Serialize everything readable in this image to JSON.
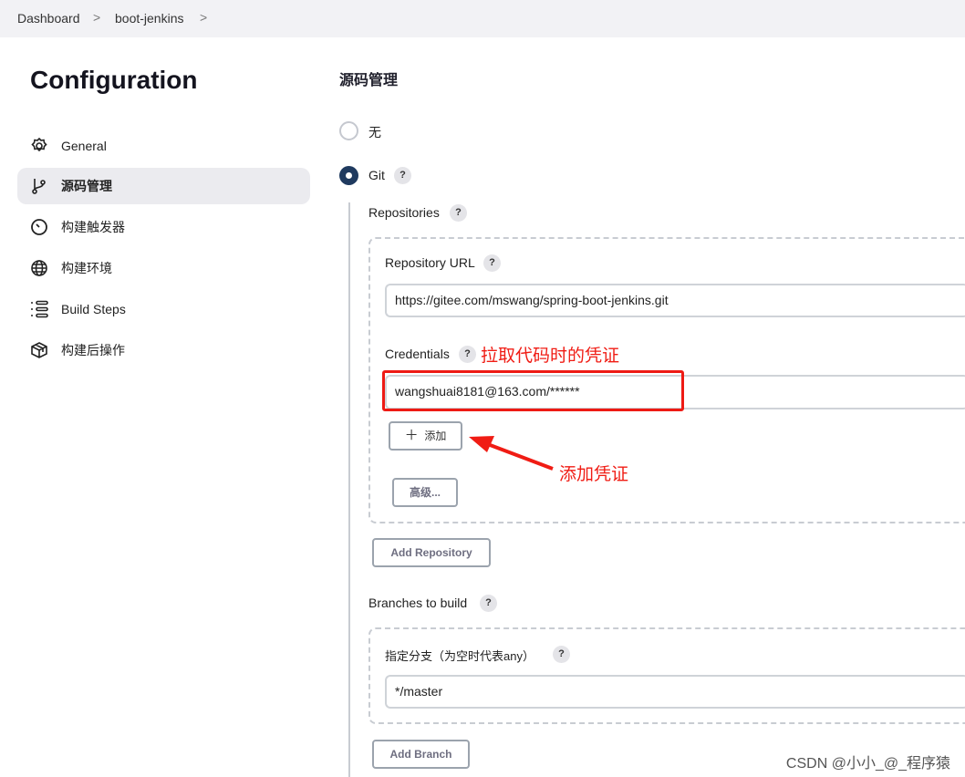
{
  "breadcrumb": {
    "items": [
      "Dashboard",
      "boot-jenkins"
    ]
  },
  "page_title": "Configuration",
  "sidebar": {
    "items": [
      {
        "label": "General",
        "icon": "gear-icon"
      },
      {
        "label": "源码管理",
        "icon": "git-branch-icon",
        "active": true
      },
      {
        "label": "构建触发器",
        "icon": "timer-icon"
      },
      {
        "label": "构建环境",
        "icon": "globe-icon"
      },
      {
        "label": "Build Steps",
        "icon": "list-icon"
      },
      {
        "label": "构建后操作",
        "icon": "package-icon"
      }
    ]
  },
  "scm": {
    "heading": "源码管理",
    "option_none": "无",
    "option_git": "Git",
    "selected": "Git",
    "repositories_label": "Repositories",
    "repo_url_label": "Repository URL",
    "repo_url": "https://gitee.com/mswang/spring-boot-jenkins.git",
    "credentials_label": "Credentials",
    "credentials_value": "wangshuai8181@163.com/******",
    "add_label": "添加",
    "advanced_label": "高级...",
    "add_repository": "Add Repository",
    "branches_label": "Branches to build",
    "branch_spec_label": "指定分支（为空时代表any）",
    "branch_spec": "*/master",
    "add_branch": "Add Branch",
    "help": "?"
  },
  "annotations": {
    "credentials_note": "拉取代码时的凭证",
    "add_note": "添加凭证",
    "accent": "#f01c14"
  },
  "watermark": "CSDN @小小_@_程序猿"
}
